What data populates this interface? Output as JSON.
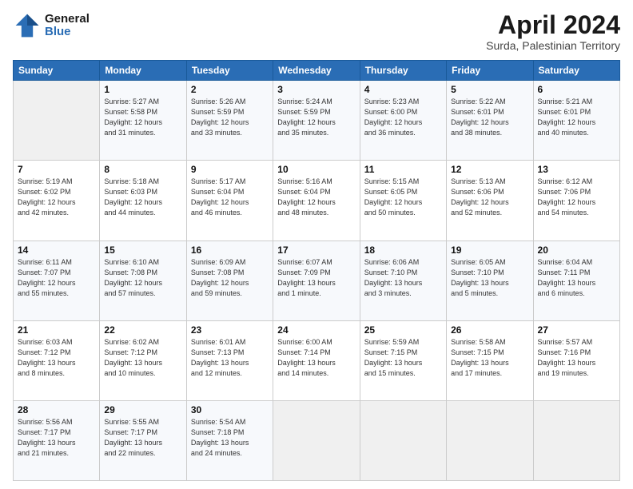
{
  "logo": {
    "line1": "General",
    "line2": "Blue"
  },
  "title": "April 2024",
  "subtitle": "Surda, Palestinian Territory",
  "header_days": [
    "Sunday",
    "Monday",
    "Tuesday",
    "Wednesday",
    "Thursday",
    "Friday",
    "Saturday"
  ],
  "weeks": [
    [
      {
        "day": "",
        "info": ""
      },
      {
        "day": "1",
        "info": "Sunrise: 5:27 AM\nSunset: 5:58 PM\nDaylight: 12 hours\nand 31 minutes."
      },
      {
        "day": "2",
        "info": "Sunrise: 5:26 AM\nSunset: 5:59 PM\nDaylight: 12 hours\nand 33 minutes."
      },
      {
        "day": "3",
        "info": "Sunrise: 5:24 AM\nSunset: 5:59 PM\nDaylight: 12 hours\nand 35 minutes."
      },
      {
        "day": "4",
        "info": "Sunrise: 5:23 AM\nSunset: 6:00 PM\nDaylight: 12 hours\nand 36 minutes."
      },
      {
        "day": "5",
        "info": "Sunrise: 5:22 AM\nSunset: 6:01 PM\nDaylight: 12 hours\nand 38 minutes."
      },
      {
        "day": "6",
        "info": "Sunrise: 5:21 AM\nSunset: 6:01 PM\nDaylight: 12 hours\nand 40 minutes."
      }
    ],
    [
      {
        "day": "7",
        "info": "Sunrise: 5:19 AM\nSunset: 6:02 PM\nDaylight: 12 hours\nand 42 minutes."
      },
      {
        "day": "8",
        "info": "Sunrise: 5:18 AM\nSunset: 6:03 PM\nDaylight: 12 hours\nand 44 minutes."
      },
      {
        "day": "9",
        "info": "Sunrise: 5:17 AM\nSunset: 6:04 PM\nDaylight: 12 hours\nand 46 minutes."
      },
      {
        "day": "10",
        "info": "Sunrise: 5:16 AM\nSunset: 6:04 PM\nDaylight: 12 hours\nand 48 minutes."
      },
      {
        "day": "11",
        "info": "Sunrise: 5:15 AM\nSunset: 6:05 PM\nDaylight: 12 hours\nand 50 minutes."
      },
      {
        "day": "12",
        "info": "Sunrise: 5:13 AM\nSunset: 6:06 PM\nDaylight: 12 hours\nand 52 minutes."
      },
      {
        "day": "13",
        "info": "Sunrise: 6:12 AM\nSunset: 7:06 PM\nDaylight: 12 hours\nand 54 minutes."
      }
    ],
    [
      {
        "day": "14",
        "info": "Sunrise: 6:11 AM\nSunset: 7:07 PM\nDaylight: 12 hours\nand 55 minutes."
      },
      {
        "day": "15",
        "info": "Sunrise: 6:10 AM\nSunset: 7:08 PM\nDaylight: 12 hours\nand 57 minutes."
      },
      {
        "day": "16",
        "info": "Sunrise: 6:09 AM\nSunset: 7:08 PM\nDaylight: 12 hours\nand 59 minutes."
      },
      {
        "day": "17",
        "info": "Sunrise: 6:07 AM\nSunset: 7:09 PM\nDaylight: 13 hours\nand 1 minute."
      },
      {
        "day": "18",
        "info": "Sunrise: 6:06 AM\nSunset: 7:10 PM\nDaylight: 13 hours\nand 3 minutes."
      },
      {
        "day": "19",
        "info": "Sunrise: 6:05 AM\nSunset: 7:10 PM\nDaylight: 13 hours\nand 5 minutes."
      },
      {
        "day": "20",
        "info": "Sunrise: 6:04 AM\nSunset: 7:11 PM\nDaylight: 13 hours\nand 6 minutes."
      }
    ],
    [
      {
        "day": "21",
        "info": "Sunrise: 6:03 AM\nSunset: 7:12 PM\nDaylight: 13 hours\nand 8 minutes."
      },
      {
        "day": "22",
        "info": "Sunrise: 6:02 AM\nSunset: 7:12 PM\nDaylight: 13 hours\nand 10 minutes."
      },
      {
        "day": "23",
        "info": "Sunrise: 6:01 AM\nSunset: 7:13 PM\nDaylight: 13 hours\nand 12 minutes."
      },
      {
        "day": "24",
        "info": "Sunrise: 6:00 AM\nSunset: 7:14 PM\nDaylight: 13 hours\nand 14 minutes."
      },
      {
        "day": "25",
        "info": "Sunrise: 5:59 AM\nSunset: 7:15 PM\nDaylight: 13 hours\nand 15 minutes."
      },
      {
        "day": "26",
        "info": "Sunrise: 5:58 AM\nSunset: 7:15 PM\nDaylight: 13 hours\nand 17 minutes."
      },
      {
        "day": "27",
        "info": "Sunrise: 5:57 AM\nSunset: 7:16 PM\nDaylight: 13 hours\nand 19 minutes."
      }
    ],
    [
      {
        "day": "28",
        "info": "Sunrise: 5:56 AM\nSunset: 7:17 PM\nDaylight: 13 hours\nand 21 minutes."
      },
      {
        "day": "29",
        "info": "Sunrise: 5:55 AM\nSunset: 7:17 PM\nDaylight: 13 hours\nand 22 minutes."
      },
      {
        "day": "30",
        "info": "Sunrise: 5:54 AM\nSunset: 7:18 PM\nDaylight: 13 hours\nand 24 minutes."
      },
      {
        "day": "",
        "info": ""
      },
      {
        "day": "",
        "info": ""
      },
      {
        "day": "",
        "info": ""
      },
      {
        "day": "",
        "info": ""
      }
    ]
  ]
}
